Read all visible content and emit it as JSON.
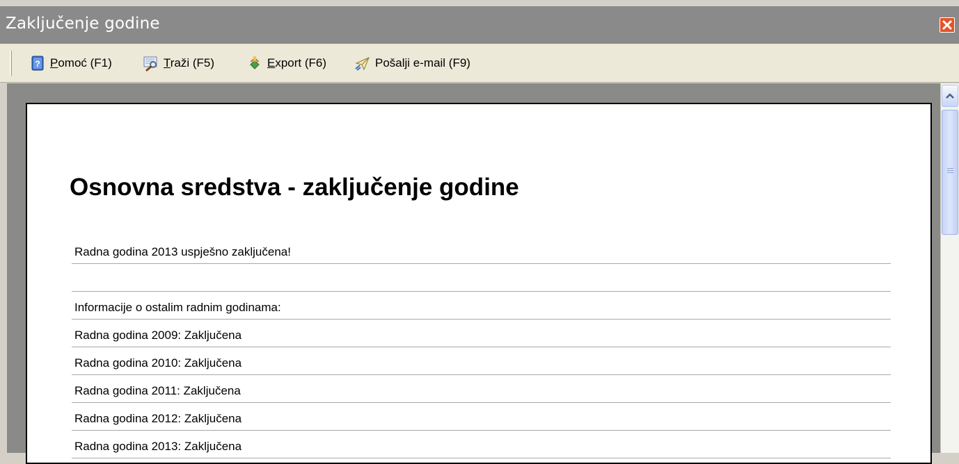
{
  "window": {
    "title": "Zaključenje godine"
  },
  "toolbar": {
    "items": [
      {
        "accel": "P",
        "rest": "omoć (F1)",
        "icon": "help-book-icon"
      },
      {
        "accel": "T",
        "rest": "raži (F5)",
        "icon": "search-icon"
      },
      {
        "accel": "E",
        "rest": "xport (F6)",
        "icon": "export-icon"
      },
      {
        "accel": "",
        "rest": "Pošalji e-mail (F9)",
        "icon": "send-email-icon"
      }
    ]
  },
  "report": {
    "title": "Osnovna sredstva - zaključenje godine",
    "status": "Radna godina 2013 uspješno zaključena!",
    "blank": "",
    "info_header": "Informacije o ostalim radnim godinama:",
    "years": [
      "Radna godina 2009: Zaključena",
      "Radna godina 2010: Zaključena",
      "Radna godina 2011: Zaključena",
      "Radna godina 2012: Zaključena",
      "Radna godina 2013: Zaključena"
    ]
  },
  "colors": {
    "titlebar": "#8a8a8a",
    "toolbar": "#ece9d8",
    "close_button": "#e4542b",
    "content_background": "#8a8a88",
    "scrollbar_thumb": "#c6d4f7"
  }
}
